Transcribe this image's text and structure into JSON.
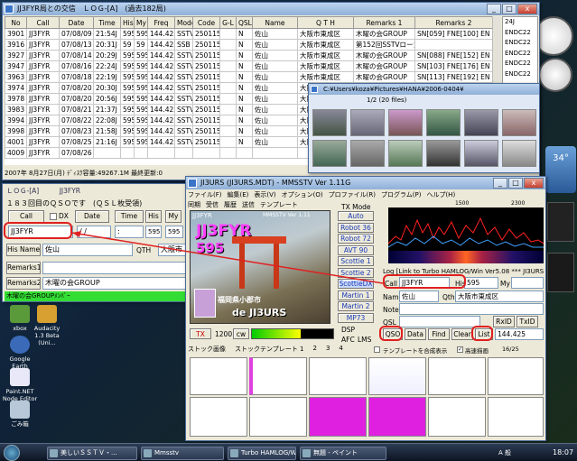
{
  "log_window": {
    "title": "JJ3FYR局との交信　ＬＯＧ-[A]　(過去182局)",
    "columns": [
      "No",
      "Call",
      "Date",
      "Time",
      "His",
      "My",
      "Freq",
      "Mode",
      "Code",
      "G-L",
      "QSL",
      "Name",
      "Q T H",
      "Remarks 1",
      "Remarks 2"
    ],
    "rows": [
      [
        "3901",
        "JJ3FYR",
        "07/08/09",
        "21:54J",
        "595",
        "595",
        "144.425",
        "SSTV",
        "250115",
        "",
        "N",
        "佐山",
        "大阪市東成区",
        "木曜の会GROUP",
        "SN[059] FNE[100] EN"
      ],
      [
        "3916",
        "JJ3FYR",
        "07/08/13",
        "20:31J",
        "59",
        "59",
        "144.425",
        "SSB",
        "250115",
        "",
        "N",
        "佐山",
        "大阪市東成区",
        "第152回SSTVローカル",
        ""
      ],
      [
        "3927",
        "JJ3FYR",
        "07/08/14",
        "20:29J",
        "595",
        "595",
        "144.425",
        "SSTV",
        "250115",
        "",
        "N",
        "佐山",
        "大阪市東成区",
        "木曜の会GROUP",
        "SN[088] FNE[152] EN"
      ],
      [
        "3947",
        "JJ3FYR",
        "07/08/16",
        "22:24J",
        "595",
        "595",
        "144.425",
        "SSTV",
        "250115",
        "",
        "N",
        "佐山",
        "大阪市東成区",
        "木曜の会GROUP",
        "SN[103] FNE[176] EN"
      ],
      [
        "3963",
        "JJ3FYR",
        "07/08/18",
        "22:19J",
        "595",
        "595",
        "144.425",
        "SSTV",
        "250115",
        "",
        "N",
        "佐山",
        "大阪市東成区",
        "木曜の会GROUP",
        "SN[113] FNE[192] EN"
      ],
      [
        "3974",
        "JJ3FYR",
        "07/08/20",
        "20:30J",
        "595",
        "595",
        "144.425",
        "SSTV",
        "250115",
        "",
        "N",
        "佐山",
        "大阪市東成区",
        "木曜の会GROUP",
        ""
      ],
      [
        "3978",
        "JJ3FYR",
        "07/08/20",
        "20:56J",
        "595",
        "595",
        "144.425",
        "SSTV",
        "250115",
        "",
        "N",
        "佐山",
        "大阪市東成区",
        "木曜の会GROUP",
        ""
      ],
      [
        "3983",
        "JJ3FYR",
        "07/08/21",
        "21:37J",
        "595",
        "595",
        "144.425",
        "SSTV",
        "250115",
        "",
        "N",
        "佐山",
        "大阪市東成区",
        "木曜の会GROUP",
        ""
      ],
      [
        "3994",
        "JJ3FYR",
        "07/08/22",
        "22:08J",
        "595",
        "595",
        "144.425",
        "SSTV",
        "250115",
        "",
        "N",
        "佐山",
        "大阪市東成区",
        "木曜の会GROUP",
        ""
      ],
      [
        "3998",
        "JJ3FYR",
        "07/08/23",
        "21:58J",
        "595",
        "595",
        "144.425",
        "SSTV",
        "250115",
        "",
        "N",
        "佐山",
        "大阪市東成区",
        "木曜の会GROUP",
        ""
      ],
      [
        "4001",
        "JJ3FYR",
        "07/08/25",
        "21:16J",
        "595",
        "595",
        "144.425",
        "SSTV",
        "250115",
        "",
        "N",
        "佐山",
        "大阪市東成区",
        "木曜の会GROUP",
        ""
      ],
      [
        "4009",
        "JJ3FYR",
        "07/08/26",
        "",
        "",
        "",
        "",
        "",
        "",
        "",
        "",
        "",
        "",
        "",
        ""
      ]
    ],
    "right_col_partial": [
      "24J",
      "ENDC22",
      "ENDC22",
      "ENDC22",
      "ENDC22",
      "ENDC22",
      "",
      "",
      "",
      "",
      "",
      ""
    ]
  },
  "status_bar": {
    "text": "2007年 8月27日(月) ﾃﾞｨｽｸ容量:49267.1M 最終更新:0"
  },
  "hamlog": {
    "title": "ＬＯＧ-[A]　　　JJ3FYR",
    "qso_count": "１８３回目のＱＳＯです　(ＱＳＬ枚受領)",
    "call_label": "Call",
    "dx_label": "DX",
    "date_label": "Date",
    "time_label": "Time",
    "his_label": "His",
    "my_label": "My",
    "call_value": "JJ3FYR",
    "date_value": "/ /",
    "time_value": ":",
    "his_value": "595",
    "my_value": "595",
    "his_name_label": "His Name",
    "name_value": "佐山",
    "qth_label": "QTH",
    "qth_value": "大阪市",
    "remarks1_label": "Remarks1",
    "remarks1_value": "",
    "remarks2_label": "Remarks2",
    "remarks2_value": "木曜の会GROUP",
    "green_text": "木曜の会GROUPﾒﾝﾊﾞｰ"
  },
  "viewer": {
    "title": "C:¥Users¥koza¥Pictures¥HANA¥2006-0404¥",
    "count": "1/2 (20 files)"
  },
  "mmsstv": {
    "title": "JI3URS (JI3URS.MDT) - MMSSTV Ver 1.11G",
    "menus": [
      "ファイル(F)",
      "編集(E)",
      "表示(V)",
      "オプション(O)",
      "プロファイル(R)",
      "プログラム(P)",
      "ヘルプ(H)"
    ],
    "tabs": [
      "同期",
      "受信",
      "履歴",
      "送信",
      "テンプレート"
    ],
    "image_callsign": "JJ3FYR",
    "image_rst": "595",
    "image_bottom": "de JI3URS",
    "image_location": "福岡県小郡市",
    "image_header": "JJ3FYR",
    "image_header2": "MMSSTV Ver 1.11",
    "tx_mode_label": "TX Mode",
    "modes": [
      "Auto",
      "Robot 36",
      "Robot 72",
      "AVT 90",
      "Scottie 1",
      "Scottie 2",
      "ScottieDX",
      "Martin 1",
      "Martin 2",
      "MP73"
    ],
    "freq_ticks": [
      "1500",
      "2300"
    ],
    "log_link": "Log [Link to Turbo HAMLOG/Win Ver5.08 *** JI3URS",
    "call_label": "Call",
    "call_value": "JJ3FYR",
    "his_label": "His",
    "his_value": "595",
    "my_label": "My",
    "name_label": "Name",
    "name_value": "佐山",
    "qth_label": "Qth",
    "qth_value": "大阪市東成区",
    "note_label": "Note",
    "qsl_label": "QSL",
    "rxid": "RxID",
    "txid": "TxID",
    "buttons": [
      "QSO",
      "Data",
      "Find",
      "Clear",
      "List"
    ],
    "freq_value": "144.425",
    "bottom_tabs": [
      "ストック画像",
      "ストックテンプレート 1",
      "2",
      "3",
      "4"
    ],
    "checkbox_label": "テンプレートを合成表示",
    "hi_speed": "高速描画",
    "page_count": "16/25",
    "tx_label": "TX",
    "val_1200": "1200",
    "cw_label": "cw",
    "dsp_label": "DSP",
    "afc_label": "AFC",
    "lms_label": "LMS"
  },
  "desktop_icons": [
    "xbox",
    "Audacity 1.3 Beta (Uni...",
    "Google Earth",
    "Paint.NET Node Editor",
    "ごみ箱"
  ],
  "taskbar": {
    "items": [
      "美しいＳＳＴＶ・...",
      "Mmsstv",
      "Turbo HAMLOG/Win",
      "無題 - ペイント"
    ],
    "clock": "18:07",
    "ime": "A 般"
  },
  "sidebar": {
    "temp": "34°",
    "weather": "お天気"
  },
  "colors": {
    "accent_red": "#e02020",
    "green_bar": "#33dd33"
  }
}
